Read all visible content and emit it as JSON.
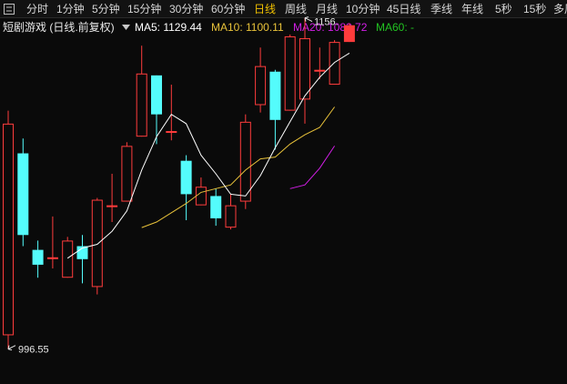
{
  "tabs": [
    {
      "label": "分时",
      "active": false
    },
    {
      "label": "1分钟",
      "active": false
    },
    {
      "label": "5分钟",
      "active": false
    },
    {
      "label": "15分钟",
      "active": false
    },
    {
      "label": "30分钟",
      "active": false
    },
    {
      "label": "60分钟",
      "active": false
    },
    {
      "label": "日线",
      "active": true
    },
    {
      "label": "周线",
      "active": false
    },
    {
      "label": "月线",
      "active": false
    },
    {
      "label": "10分钟",
      "active": false
    },
    {
      "label": "45日线",
      "active": false
    },
    {
      "label": "季线",
      "active": false
    },
    {
      "label": "年线",
      "active": false
    },
    {
      "label": "5秒",
      "active": false
    },
    {
      "label": "15秒",
      "active": false
    },
    {
      "label": "多周",
      "active": false
    }
  ],
  "info": {
    "title": "短剧游戏 (日线.前复权)",
    "ma5": "MA5: 1129.44",
    "ma10": "MA10: 1100.11",
    "ma20": "MA20: 1082.72",
    "ma60": "MA60: -"
  },
  "colors": {
    "up": "#ff3c3c",
    "down": "#54fcfc",
    "ma5": "#ffffff",
    "ma10": "#e8c23a",
    "ma20": "#d21ee6",
    "ma60": "#22c322",
    "active_tab": "#f0c000"
  },
  "chart_data": {
    "type": "candlestick",
    "ylim": [
      990,
      1165
    ],
    "high_label": "1156.",
    "low_label": "996.55",
    "candles": [
      {
        "o": 1004,
        "c": 1118,
        "h": 1125,
        "l": 996.55
      },
      {
        "o": 1102,
        "c": 1058,
        "h": 1110,
        "l": 1052
      },
      {
        "o": 1050,
        "c": 1042,
        "h": 1055,
        "l": 1035
      },
      {
        "o": 1046,
        "c": 1046,
        "h": 1068,
        "l": 1040
      },
      {
        "o": 1035,
        "c": 1055,
        "h": 1057,
        "l": 1035
      },
      {
        "o": 1052,
        "c": 1045,
        "h": 1058,
        "l": 1032
      },
      {
        "o": 1030,
        "c": 1077,
        "h": 1078,
        "l": 1026
      },
      {
        "o": 1074,
        "c": 1074,
        "h": 1091,
        "l": 1065
      },
      {
        "o": 1076,
        "c": 1106,
        "h": 1108,
        "l": 1076
      },
      {
        "o": 1111,
        "c": 1145,
        "h": 1160,
        "l": 1111
      },
      {
        "o": 1144,
        "c": 1123,
        "h": 1144,
        "l": 1107
      },
      {
        "o": 1114,
        "c": 1114,
        "h": 1139,
        "l": 1109
      },
      {
        "o": 1098,
        "c": 1080,
        "h": 1101,
        "l": 1066
      },
      {
        "o": 1074,
        "c": 1084,
        "h": 1089,
        "l": 1074
      },
      {
        "o": 1079,
        "c": 1067,
        "h": 1083,
        "l": 1063
      },
      {
        "o": 1062,
        "c": 1074,
        "h": 1080,
        "l": 1061
      },
      {
        "o": 1076,
        "c": 1119,
        "h": 1123,
        "l": 1072
      },
      {
        "o": 1128,
        "c": 1149,
        "h": 1159,
        "l": 1124
      },
      {
        "o": 1146,
        "c": 1120,
        "h": 1147,
        "l": 1104
      },
      {
        "o": 1125,
        "c": 1165,
        "h": 1166,
        "l": 1125
      },
      {
        "o": 1131,
        "c": 1164,
        "h": 1175,
        "l": 1118
      },
      {
        "o": 1147,
        "c": 1147,
        "h": 1159,
        "l": 1142
      },
      {
        "o": 1139,
        "c": 1162,
        "h": 1163,
        "l": 1139
      },
      {
        "o": 1162,
        "c": 1171,
        "h": 1172,
        "l": 1162
      }
    ],
    "ma5": [
      null,
      null,
      null,
      null,
      1045.5,
      1051,
      1053,
      1060,
      1071,
      1093,
      1111,
      1123,
      1118,
      1101,
      1091,
      1080,
      1079,
      1090,
      1105,
      1119,
      1133,
      1143,
      1151,
      1156
    ],
    "ma10": [
      null,
      null,
      null,
      null,
      null,
      null,
      null,
      null,
      null,
      1062,
      1065,
      1070,
      1075,
      1081,
      1083,
      1085,
      1093,
      1099,
      1100,
      1107,
      1112,
      1116,
      1127
    ],
    "ma20": [
      null,
      null,
      null,
      null,
      null,
      null,
      null,
      null,
      null,
      null,
      null,
      null,
      null,
      null,
      null,
      null,
      null,
      null,
      null,
      1083,
      1085,
      1094,
      1106
    ],
    "ma60": []
  }
}
